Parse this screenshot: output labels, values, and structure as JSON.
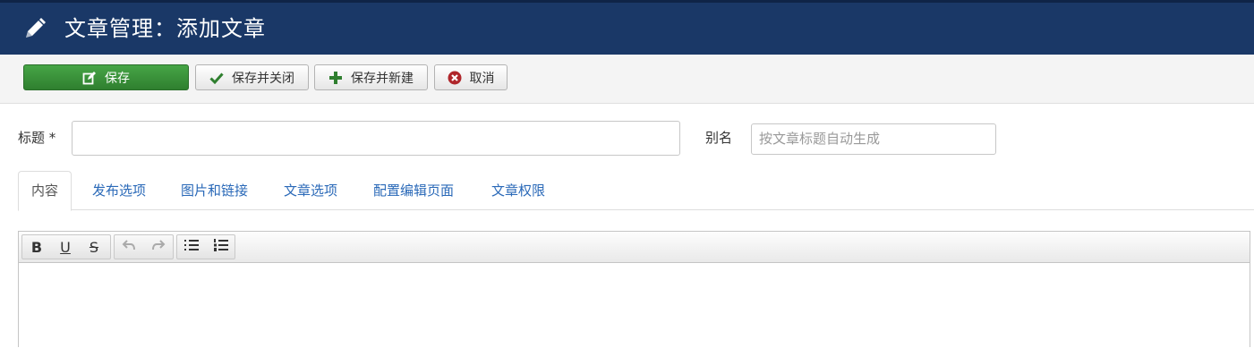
{
  "header": {
    "title": "文章管理：添加文章",
    "icon": "pencil-icon"
  },
  "toolbar": {
    "save_label": "保存",
    "save_close_label": "保存并关闭",
    "save_new_label": "保存并新建",
    "cancel_label": "取消",
    "save_color": "#3c9a3c"
  },
  "form": {
    "title_label": "标题 *",
    "title_value": "",
    "alias_label": "别名",
    "alias_placeholder": "按文章标题自动生成"
  },
  "tabs": [
    {
      "label": "内容",
      "active": true
    },
    {
      "label": "发布选项"
    },
    {
      "label": "图片和链接"
    },
    {
      "label": "文章选项"
    },
    {
      "label": "配置编辑页面"
    },
    {
      "label": "文章权限"
    }
  ],
  "editor": {
    "tools": {
      "bold": "B",
      "underline": "U",
      "strike": "S"
    },
    "icons": [
      "undo-icon",
      "redo-icon",
      "bullet-list-icon",
      "numbered-list-icon"
    ]
  },
  "colors": {
    "header_bg": "#1a3867",
    "link": "#2a69b8"
  }
}
